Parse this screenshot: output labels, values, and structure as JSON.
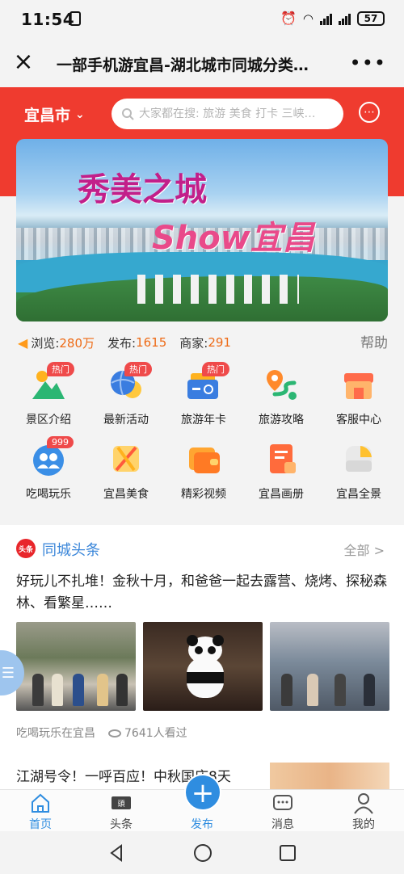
{
  "status_bar": {
    "time": "11:54",
    "battery": "57"
  },
  "title_bar": {
    "title": "一部手机游宜昌-湖北城市同城分类…"
  },
  "header": {
    "city": "宜昌市",
    "search_placeholder": "大家都在搜: 旅游 美食 打卡 三峡…"
  },
  "banner": {
    "slogan": "秀美之城",
    "show_text": "Show宜昌"
  },
  "stats": {
    "views_label": "浏览:",
    "views": "280万",
    "posts_label": "发布:",
    "posts": "1615",
    "merchants_label": "商家:",
    "merchants": "291",
    "help": "帮助"
  },
  "grid": [
    {
      "label": "景区介绍",
      "badge": "热门",
      "icon": "mountain-icon"
    },
    {
      "label": "最新活动",
      "badge": "热门",
      "icon": "basketball-icon"
    },
    {
      "label": "旅游年卡",
      "badge": "热门",
      "icon": "card-icon"
    },
    {
      "label": "旅游攻略",
      "badge": "",
      "icon": "route-pin-icon"
    },
    {
      "label": "客服中心",
      "badge": "",
      "icon": "store-icon"
    },
    {
      "label": "吃喝玩乐",
      "badge": "999",
      "icon": "people-icon"
    },
    {
      "label": "宜昌美食",
      "badge": "",
      "icon": "cutlery-icon"
    },
    {
      "label": "精彩视频",
      "badge": "",
      "icon": "wallet-icon"
    },
    {
      "label": "宜昌画册",
      "badge": "",
      "icon": "document-icon"
    },
    {
      "label": "宜昌全景",
      "badge": "",
      "icon": "panorama-icon"
    }
  ],
  "news": {
    "section_title": "同城头条",
    "section_badge": "头条",
    "all_label": "全部 >",
    "headline": "好玩儿不扎堆！金秋十月，和爸爸一起去露营、烧烤、探秘森林、看繁星……",
    "source": "吃喝玩乐在宜昌",
    "views": "7641人看过",
    "second_headline": "江湖号令！一呼百应！中秋国庆8天"
  },
  "tabbar": {
    "tabs": [
      {
        "label": "首页",
        "icon": "home-icon"
      },
      {
        "label": "头条",
        "icon": "headline-icon"
      },
      {
        "label": "发布",
        "icon": "plus-icon"
      },
      {
        "label": "消息",
        "icon": "message-icon"
      },
      {
        "label": "我的",
        "icon": "user-icon"
      }
    ]
  },
  "colors": {
    "brand_red": "#ef3b2f",
    "accent_blue": "#2f8de0",
    "stat_orange": "#ee6a15"
  }
}
